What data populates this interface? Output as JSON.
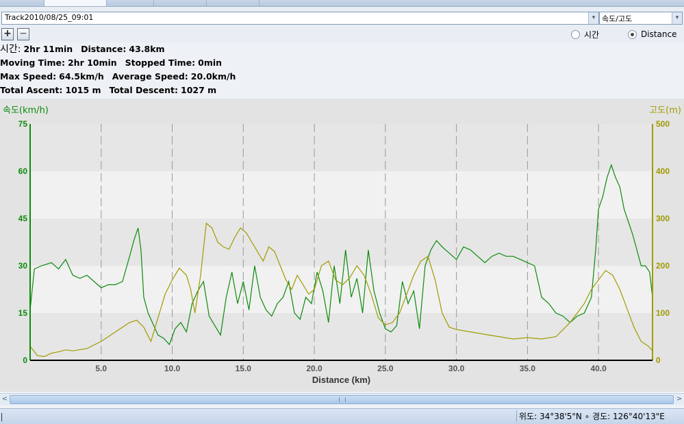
{
  "track": {
    "selected": "Track2010/08/25_09:01"
  },
  "mode": {
    "selected": "속도/고도"
  },
  "zoom": {
    "in": "+",
    "out": "−"
  },
  "xaxis_mode": {
    "options": [
      "시간",
      "Distance"
    ],
    "selected": "Distance"
  },
  "stats": {
    "line1": {
      "time_label": "시간:",
      "time_value": "2hr 11min",
      "distance_label": "Distance:",
      "distance_value": "43.8km"
    },
    "line2": {
      "moving_label": "Moving Time:",
      "moving_value": "2hr 10min",
      "stopped_label": "Stopped Time:",
      "stopped_value": "0min"
    },
    "line3": {
      "maxspeed_label": "Max Speed:",
      "maxspeed_value": "64.5km/h",
      "avgspeed_label": "Average Speed:",
      "avgspeed_value": "20.0km/h"
    },
    "line4": {
      "ascent_label": "Total Ascent:",
      "ascent_value": "1015 m",
      "descent_label": "Total Descent:",
      "descent_value": "1027 m"
    }
  },
  "colors": {
    "speed": "#0a8a0a",
    "elevation": "#a09a00",
    "axis": "#000000"
  },
  "chart_data": {
    "type": "line",
    "xlabel": "Distance (km)",
    "ylabel_left": "속도(km/h)",
    "ylabel_right": "고도(m)",
    "xlim": [
      0,
      43.8
    ],
    "ylim_left": [
      0,
      75
    ],
    "ylim_right": [
      0,
      500
    ],
    "xticks": [
      "5.0",
      "10.0",
      "15.0",
      "20.0",
      "25.0",
      "30.0",
      "35.0",
      "40.0"
    ],
    "yticks_left": [
      "0",
      "15",
      "30",
      "45",
      "60",
      "75"
    ],
    "yticks_right": [
      "0",
      "100",
      "200",
      "300",
      "400",
      "500"
    ],
    "grid": "vertical dashed",
    "series": [
      {
        "name": "속도",
        "axis": "left",
        "x": [
          0,
          0.3,
          0.8,
          1.5,
          2.0,
          2.5,
          3.0,
          3.5,
          4.0,
          4.5,
          5.0,
          5.5,
          6.0,
          6.5,
          7.0,
          7.3,
          7.6,
          7.8,
          8.0,
          8.3,
          8.6,
          9.0,
          9.4,
          9.8,
          10.2,
          10.6,
          11.0,
          11.4,
          11.8,
          12.2,
          12.6,
          13.0,
          13.4,
          13.8,
          14.2,
          14.6,
          15.0,
          15.4,
          15.8,
          16.2,
          16.6,
          17.0,
          17.4,
          17.8,
          18.2,
          18.6,
          19.0,
          19.4,
          19.8,
          20.2,
          20.6,
          21.0,
          21.4,
          21.8,
          22.2,
          22.6,
          23.0,
          23.4,
          23.8,
          24.2,
          24.6,
          25.0,
          25.4,
          25.8,
          26.2,
          26.6,
          27.0,
          27.4,
          27.8,
          28.2,
          28.6,
          29.0,
          29.5,
          30.0,
          30.5,
          31.0,
          31.5,
          32.0,
          32.5,
          33.0,
          33.5,
          34.0,
          34.5,
          35.0,
          35.5,
          36.0,
          36.5,
          37.0,
          37.5,
          38.0,
          38.5,
          39.0,
          39.5,
          39.8,
          40.0,
          40.3,
          40.6,
          40.9,
          41.2,
          41.5,
          41.8,
          42.1,
          42.4,
          42.7,
          43.0,
          43.3,
          43.6,
          43.8
        ],
        "values": [
          16,
          29,
          30,
          31,
          29,
          32,
          27,
          26,
          27,
          25,
          23,
          24,
          24,
          25,
          33,
          38,
          42,
          35,
          20,
          15,
          12,
          8,
          7,
          5,
          10,
          12,
          9,
          18,
          22,
          25,
          14,
          11,
          8,
          20,
          28,
          18,
          25,
          16,
          30,
          20,
          16,
          14,
          18,
          20,
          25,
          15,
          13,
          20,
          18,
          28,
          22,
          12,
          30,
          18,
          35,
          20,
          26,
          15,
          35,
          22,
          15,
          10,
          9,
          11,
          25,
          18,
          22,
          10,
          30,
          35,
          38,
          36,
          34,
          32,
          36,
          35,
          33,
          31,
          33,
          34,
          33,
          33,
          32,
          31,
          30,
          20,
          18,
          15,
          14,
          12,
          14,
          15,
          20,
          35,
          48,
          52,
          58,
          62,
          58,
          55,
          48,
          44,
          40,
          35,
          30,
          30,
          28,
          20
        ]
      },
      {
        "name": "고도",
        "axis": "right",
        "x": [
          0,
          0.5,
          1.0,
          1.5,
          2.0,
          2.5,
          3.0,
          4.0,
          5.0,
          6.0,
          7.0,
          7.5,
          8.0,
          8.5,
          9.0,
          9.5,
          10.0,
          10.5,
          11.0,
          11.3,
          11.6,
          12.0,
          12.4,
          12.8,
          13.2,
          13.6,
          14.0,
          14.4,
          14.8,
          15.2,
          15.6,
          16.0,
          16.4,
          16.8,
          17.2,
          17.6,
          18.0,
          18.4,
          18.8,
          19.2,
          19.6,
          20.0,
          20.5,
          21.0,
          21.5,
          22.0,
          22.5,
          23.0,
          23.5,
          24.0,
          24.5,
          25.0,
          25.5,
          26.0,
          26.5,
          27.0,
          27.5,
          28.0,
          28.5,
          29.0,
          29.5,
          30.0,
          31.0,
          32.0,
          33.0,
          34.0,
          35.0,
          36.0,
          37.0,
          38.0,
          38.5,
          39.0,
          39.5,
          40.0,
          40.5,
          41.0,
          41.5,
          42.0,
          42.5,
          43.0,
          43.5,
          43.8
        ],
        "values": [
          30,
          10,
          8,
          15,
          18,
          22,
          20,
          25,
          40,
          60,
          80,
          85,
          70,
          40,
          90,
          140,
          170,
          195,
          180,
          150,
          100,
          180,
          290,
          280,
          250,
          240,
          235,
          260,
          280,
          270,
          250,
          230,
          210,
          240,
          230,
          200,
          170,
          150,
          180,
          160,
          140,
          150,
          200,
          210,
          170,
          160,
          175,
          200,
          180,
          140,
          90,
          75,
          80,
          100,
          140,
          180,
          210,
          220,
          170,
          100,
          70,
          65,
          60,
          55,
          50,
          45,
          48,
          45,
          50,
          80,
          100,
          120,
          150,
          170,
          190,
          180,
          150,
          110,
          70,
          40,
          30,
          20
        ]
      }
    ]
  },
  "scrollbar": {
    "left_arrow": "<",
    "right_arrow": ">"
  },
  "status": {
    "coords": "위도: 34°38'5\"N ∘ 경도: 126°40'13\"E"
  }
}
